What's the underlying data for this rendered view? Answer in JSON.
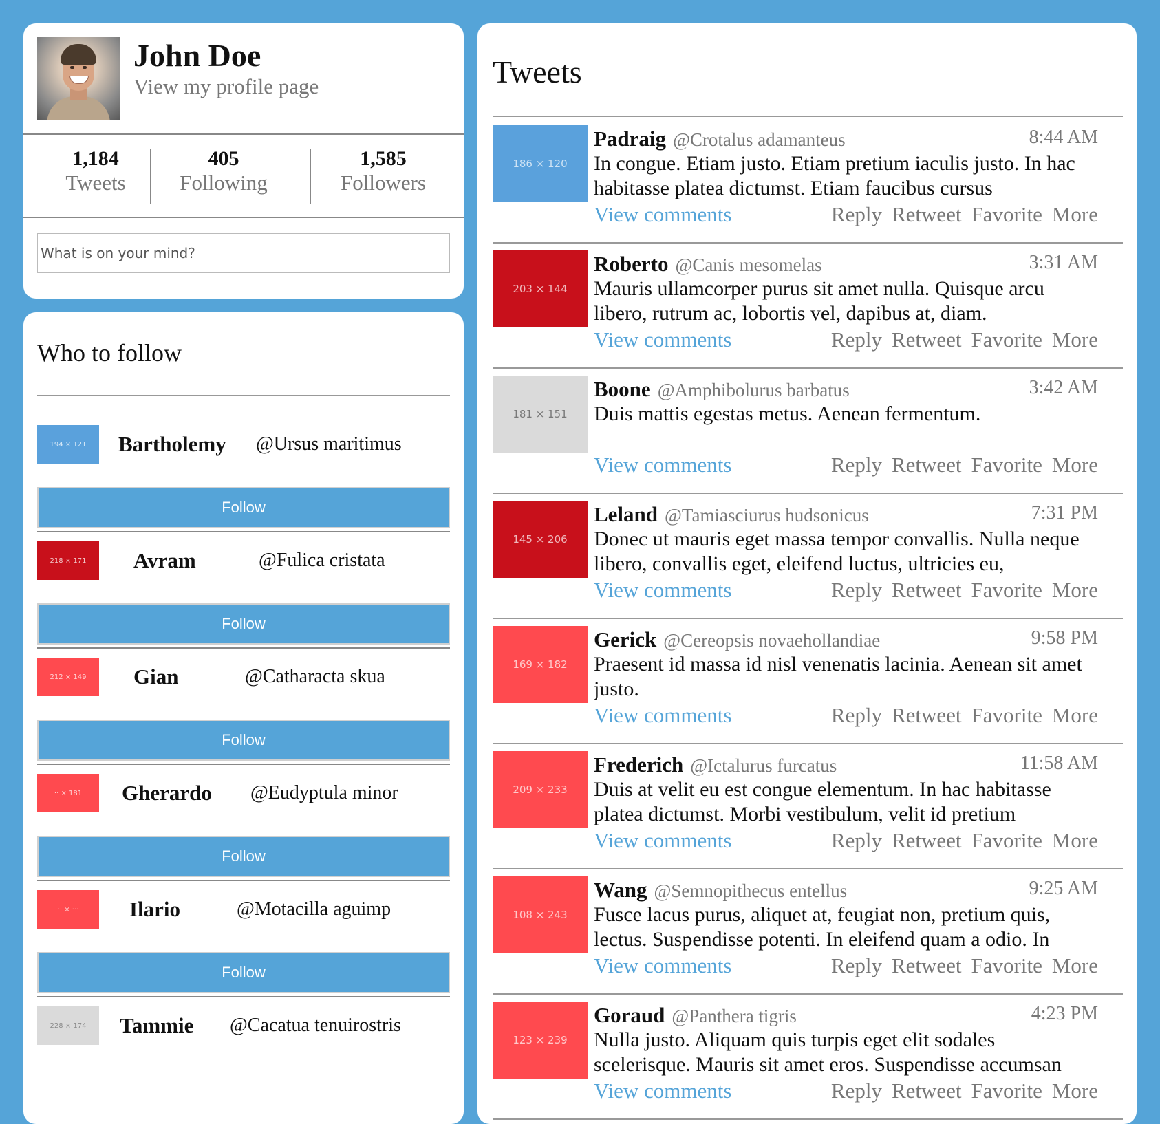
{
  "profile": {
    "name": "John Doe",
    "link": "View my profile page",
    "stats": [
      {
        "value": "1,184",
        "label": "Tweets"
      },
      {
        "value": "405",
        "label": "Following"
      },
      {
        "value": "1,585",
        "label": "Followers"
      }
    ],
    "compose_placeholder": "What is on your mind?"
  },
  "who_to_follow": {
    "title": "Who to follow",
    "button_label": "Follow",
    "items": [
      {
        "name": "Bartholemy",
        "handle": "@Ursus maritimus",
        "thumb": "194 × 121",
        "color": "#5aa1dc"
      },
      {
        "name": "Avram",
        "handle": "@Fulica cristata",
        "thumb": "218 × 171",
        "color": "#c8101b"
      },
      {
        "name": "Gian",
        "handle": "@Catharacta skua",
        "thumb": "212 × 149",
        "color": "#ff4a4f"
      },
      {
        "name": "Gherardo",
        "handle": "@Eudyptula minor",
        "thumb": "·· × 181",
        "color": "#ff4a4f"
      },
      {
        "name": "Ilario",
        "handle": "@Motacilla aguimp",
        "thumb": "·· × ···",
        "color": "#ff4a4f"
      },
      {
        "name": "Tammie",
        "handle": "@Cacatua tenuirostris",
        "thumb": "228 × 174",
        "color": "#dadada"
      }
    ]
  },
  "tweets": {
    "title": "Tweets",
    "view_comments": "View comments",
    "actions": [
      "Reply",
      "Retweet",
      "Favorite",
      "More"
    ],
    "items": [
      {
        "name": "Padraig",
        "handle": "@Crotalus adamanteus",
        "time": "8:44 AM",
        "text": "In congue. Etiam justo. Etiam pretium iaculis justo. In hac habitasse platea dictumst. Etiam faucibus cursus",
        "thumb": "186 × 120",
        "color": "#5aa1dc"
      },
      {
        "name": "Roberto",
        "handle": "@Canis mesomelas",
        "time": "3:31 AM",
        "text": "Mauris ullamcorper purus sit amet nulla. Quisque arcu libero, rutrum ac, lobortis vel, dapibus at, diam.",
        "thumb": "203 × 144",
        "color": "#c8101b"
      },
      {
        "name": "Boone",
        "handle": "@Amphibolurus barbatus",
        "time": "3:42 AM",
        "text": "Duis mattis egestas metus. Aenean fermentum.",
        "thumb": "181 × 151",
        "color": "#dadada"
      },
      {
        "name": "Leland",
        "handle": "@Tamiasciurus hudsonicus",
        "time": "7:31 PM",
        "text": "Donec ut mauris eget massa tempor convallis. Nulla neque libero, convallis eget, eleifend luctus, ultricies eu,",
        "thumb": "145 × 206",
        "color": "#c8101b"
      },
      {
        "name": "Gerick",
        "handle": "@Cereopsis novaehollandiae",
        "time": "9:58 PM",
        "text": "Praesent id massa id nisl venenatis lacinia. Aenean sit amet justo.",
        "thumb": "169 × 182",
        "color": "#ff4a4f"
      },
      {
        "name": "Frederich",
        "handle": "@Ictalurus furcatus",
        "time": "11:58 AM",
        "text": "Duis at velit eu est congue elementum. In hac habitasse platea dictumst. Morbi vestibulum, velit id pretium",
        "thumb": "209 × 233",
        "color": "#ff4a4f"
      },
      {
        "name": "Wang",
        "handle": "@Semnopithecus entellus",
        "time": "9:25 AM",
        "text": "Fusce lacus purus, aliquet at, feugiat non, pretium quis, lectus. Suspendisse potenti. In eleifend quam a odio. In",
        "thumb": "108 × 243",
        "color": "#ff4a4f"
      },
      {
        "name": "Goraud",
        "handle": "@Panthera tigris",
        "time": "4:23 PM",
        "text": "Nulla justo. Aliquam quis turpis eget elit sodales scelerisque. Mauris sit amet eros. Suspendisse accumsan",
        "thumb": "123 × 239",
        "color": "#ff4a4f"
      }
    ]
  }
}
